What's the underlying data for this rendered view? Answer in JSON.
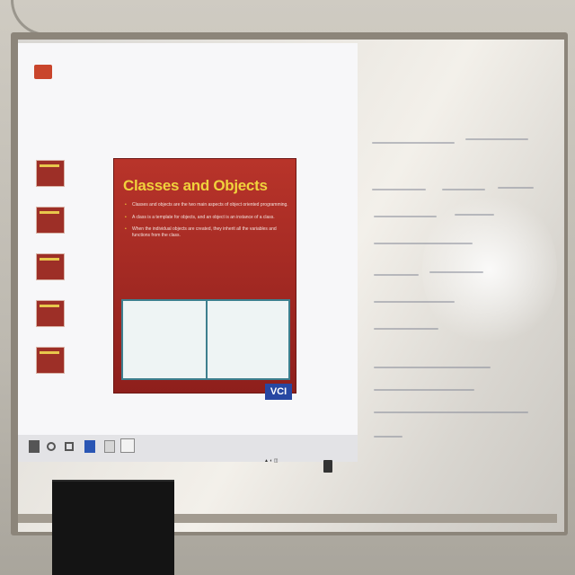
{
  "slide": {
    "title": "Classes and Objects",
    "bullets": [
      "Classes and objects are the two main aspects of object oriented programming.",
      "A class is a template for objects, and an object is an instance of a class.",
      "When the individual objects are created, they inherit all the variables and functions from the class."
    ],
    "logo_text": "VCI"
  },
  "colors": {
    "slide_red": "#b8342a",
    "slide_title": "#f0d23c",
    "whiteboard": "#ece9e3"
  },
  "icons": [
    "start-icon",
    "search-icon",
    "task-view-icon",
    "notification-icon"
  ]
}
